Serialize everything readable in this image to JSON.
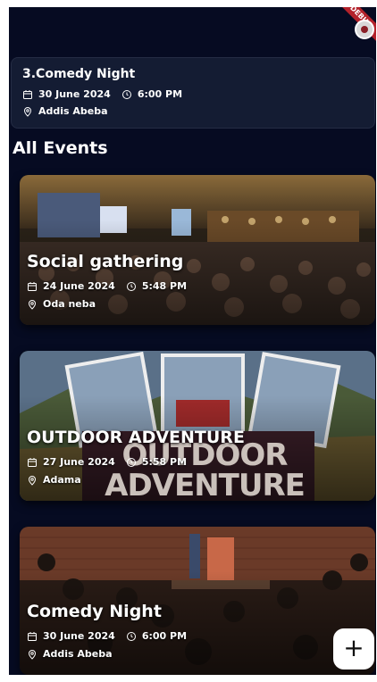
{
  "debug_banner": "DEBUG",
  "highlight": {
    "title": "3.Comedy Night",
    "date": "30 June 2024",
    "time": "6:00 PM",
    "location": "Addis Abeba"
  },
  "section_title": "All Events",
  "events": [
    {
      "title": "Social gathering",
      "date": "24 June 2024",
      "time": "5:48 PM",
      "location": "Oda neba"
    },
    {
      "title": "OUTDOOR ADVENTURE",
      "date": "27 June 2024",
      "time": "5:58 PM",
      "location": "Adama",
      "poster_text": "OUTDOOR ADVENTURE"
    },
    {
      "title": "Comedy Night",
      "date": "30 June 2024",
      "time": "6:00 PM",
      "location": "Addis Abeba"
    }
  ],
  "fab": {
    "label": "+"
  },
  "icons": {
    "calendar": "calendar-icon",
    "clock": "clock-icon",
    "location": "location-pin-icon",
    "add": "add-icon"
  }
}
